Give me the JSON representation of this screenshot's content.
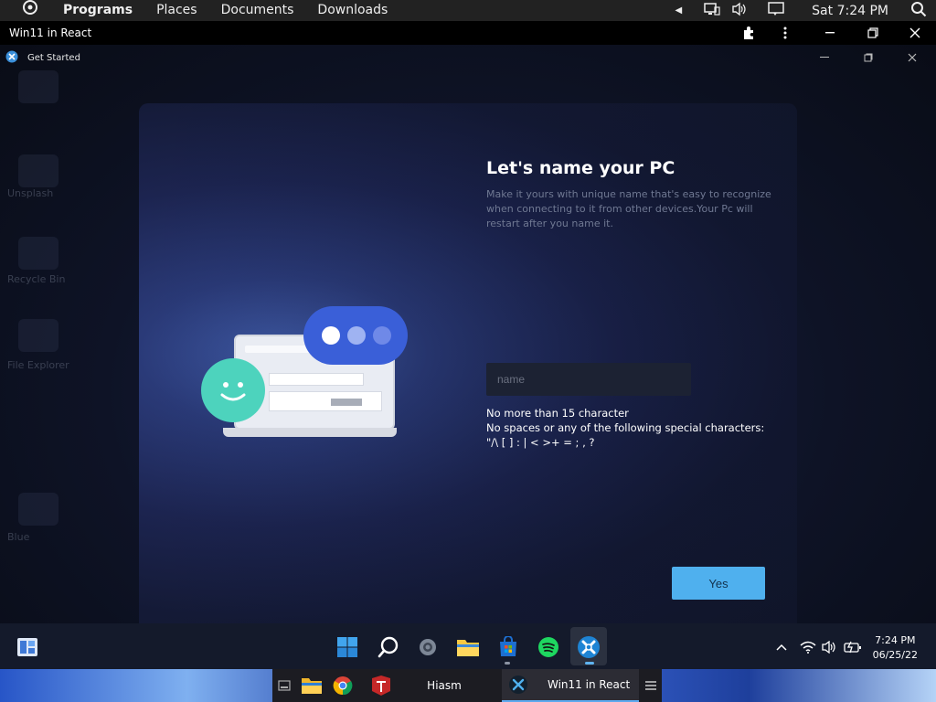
{
  "topbar": {
    "menus": [
      "Programs",
      "Places",
      "Documents",
      "Downloads"
    ],
    "clock": "Sat 7:24 PM"
  },
  "appbar": {
    "title": "Win11 in React"
  },
  "desktop": {
    "icon_labels": [
      "Unsplash",
      "Recycle Bin",
      "File Explorer",
      "Blue"
    ]
  },
  "window": {
    "title": "Get Started"
  },
  "dialog": {
    "heading": "Let's name your PC",
    "description": "Make it yours with unique name that's easy to recognize when connecting to it from other devices.Your Pc will restart after you name it.",
    "input_placeholder": "name",
    "input_value": "",
    "rule1": "No more than 15 character",
    "rule2": "No spaces or any of the following special characters:",
    "rule3": "\"/\\ [ ] : | < >+ = ; , ?",
    "yes_label": "Yes"
  },
  "taskbar": {
    "time": "7:24 PM",
    "date": "06/25/22",
    "pinned": [
      "start-icon",
      "search-icon",
      "settings-icon",
      "file-explorer-icon",
      "store-icon",
      "spotify-icon",
      "win11-react-icon"
    ]
  },
  "host_taskbar": {
    "tabs": [
      "Hiasm",
      "Win11 in React"
    ]
  },
  "colors": {
    "accent": "#4fb0ee",
    "dialog_bg": "#1c2450",
    "taskbar_bg": "#141a2b"
  }
}
